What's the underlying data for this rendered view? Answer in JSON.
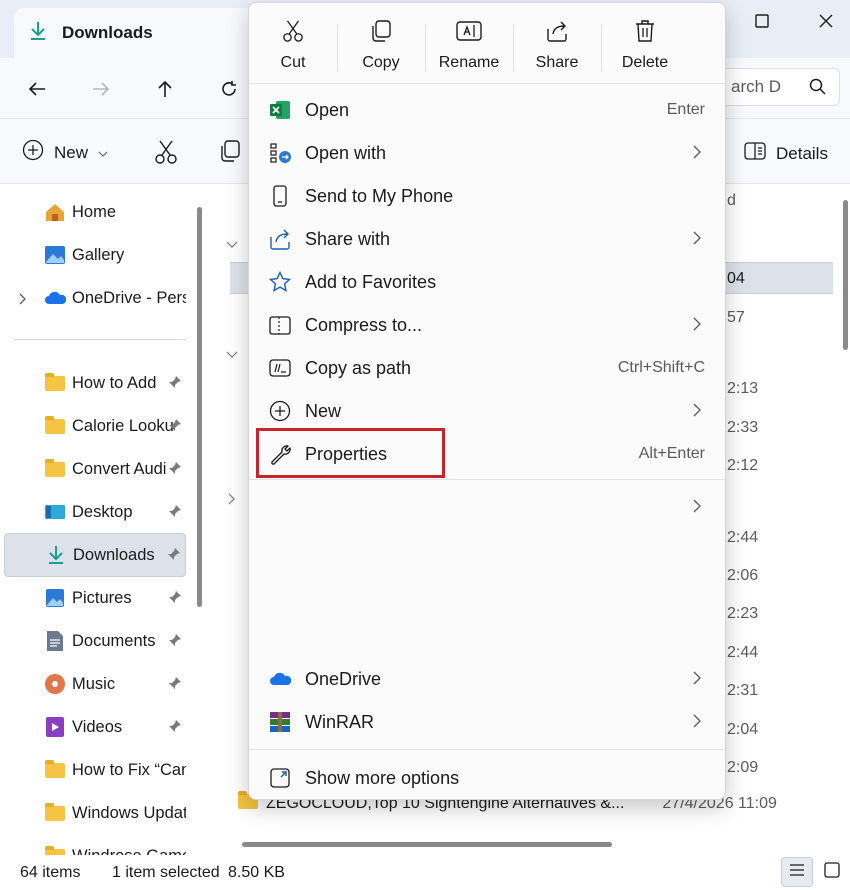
{
  "window": {
    "tab_title": "Downloads"
  },
  "navbar": {
    "search_partial": "arch D"
  },
  "toolbar": {
    "new_label": "New",
    "details_label": "Details"
  },
  "sidebar": {
    "top_items": [
      {
        "label": "Home",
        "icon": "home-icon"
      },
      {
        "label": "Gallery",
        "icon": "gallery-icon"
      },
      {
        "label": "OneDrive - Perso",
        "icon": "onedrive-icon"
      }
    ],
    "pinned_items": [
      {
        "label": "How to Add",
        "icon": "folder-icon"
      },
      {
        "label": "Calorie Looku",
        "icon": "folder-icon"
      },
      {
        "label": "Convert Audi",
        "icon": "folder-icon"
      },
      {
        "label": "Desktop",
        "icon": "desktop-icon"
      },
      {
        "label": "Downloads",
        "icon": "download-icon"
      },
      {
        "label": "Pictures",
        "icon": "pictures-icon"
      },
      {
        "label": "Documents",
        "icon": "documents-icon"
      },
      {
        "label": "Music",
        "icon": "music-icon"
      },
      {
        "label": "Videos",
        "icon": "videos-icon"
      },
      {
        "label": "How to Fix “Can",
        "icon": "folder-icon"
      },
      {
        "label": "Windows Updat",
        "icon": "folder-icon"
      },
      {
        "label": "Windrose Game",
        "icon": "folder-icon"
      }
    ]
  },
  "content": {
    "header_peek": "d",
    "row_peeks": [
      "04",
      "57",
      "2:13",
      "2:33",
      "2:12",
      "2:44",
      "2:06",
      "2:23",
      "2:44",
      "2:31",
      "2:04",
      "2:09"
    ],
    "last_row_name": "ZEGOCLOUD,Top 10 Sightengine Alternatives &...",
    "last_row_date": "27/4/2026 11:09"
  },
  "status": {
    "item_count": "64 items",
    "selection": "1 item selected",
    "size": "8.50 KB"
  },
  "context_menu": {
    "quick_actions": [
      {
        "label": "Cut",
        "icon": "cut-icon"
      },
      {
        "label": "Copy",
        "icon": "copy-icon"
      },
      {
        "label": "Rename",
        "icon": "rename-icon"
      },
      {
        "label": "Share",
        "icon": "share-icon"
      },
      {
        "label": "Delete",
        "icon": "delete-icon"
      }
    ],
    "items": [
      {
        "label": "Open",
        "shortcut": "Enter",
        "icon": "excel-icon"
      },
      {
        "label": "Open with",
        "icon": "open-with-icon",
        "submenu": true
      },
      {
        "label": "Send to My Phone",
        "icon": "phone-icon"
      },
      {
        "label": "Share with",
        "icon": "share-with-icon",
        "submenu": true
      },
      {
        "label": "Add to Favorites",
        "icon": "star-icon"
      },
      {
        "label": "Compress to...",
        "icon": "compress-icon",
        "submenu": true
      },
      {
        "label": "Copy as path",
        "shortcut": "Ctrl+Shift+C",
        "icon": "copy-path-icon"
      },
      {
        "label": "New",
        "icon": "new-icon",
        "submenu": true
      },
      {
        "label": "Properties",
        "shortcut": "Alt+Enter",
        "icon": "wrench-icon",
        "highlighted": true
      },
      {
        "label": "OneDrive",
        "icon": "onedrive-icon",
        "submenu": true
      },
      {
        "label": "WinRAR",
        "icon": "winrar-icon",
        "submenu": true
      },
      {
        "label": "Show more options",
        "icon": "more-options-icon"
      }
    ],
    "highlight_color": "#c8242b"
  },
  "colors": {
    "accent": "#0078d4",
    "folder": "#f5c442",
    "excel": "#1d6f42"
  }
}
